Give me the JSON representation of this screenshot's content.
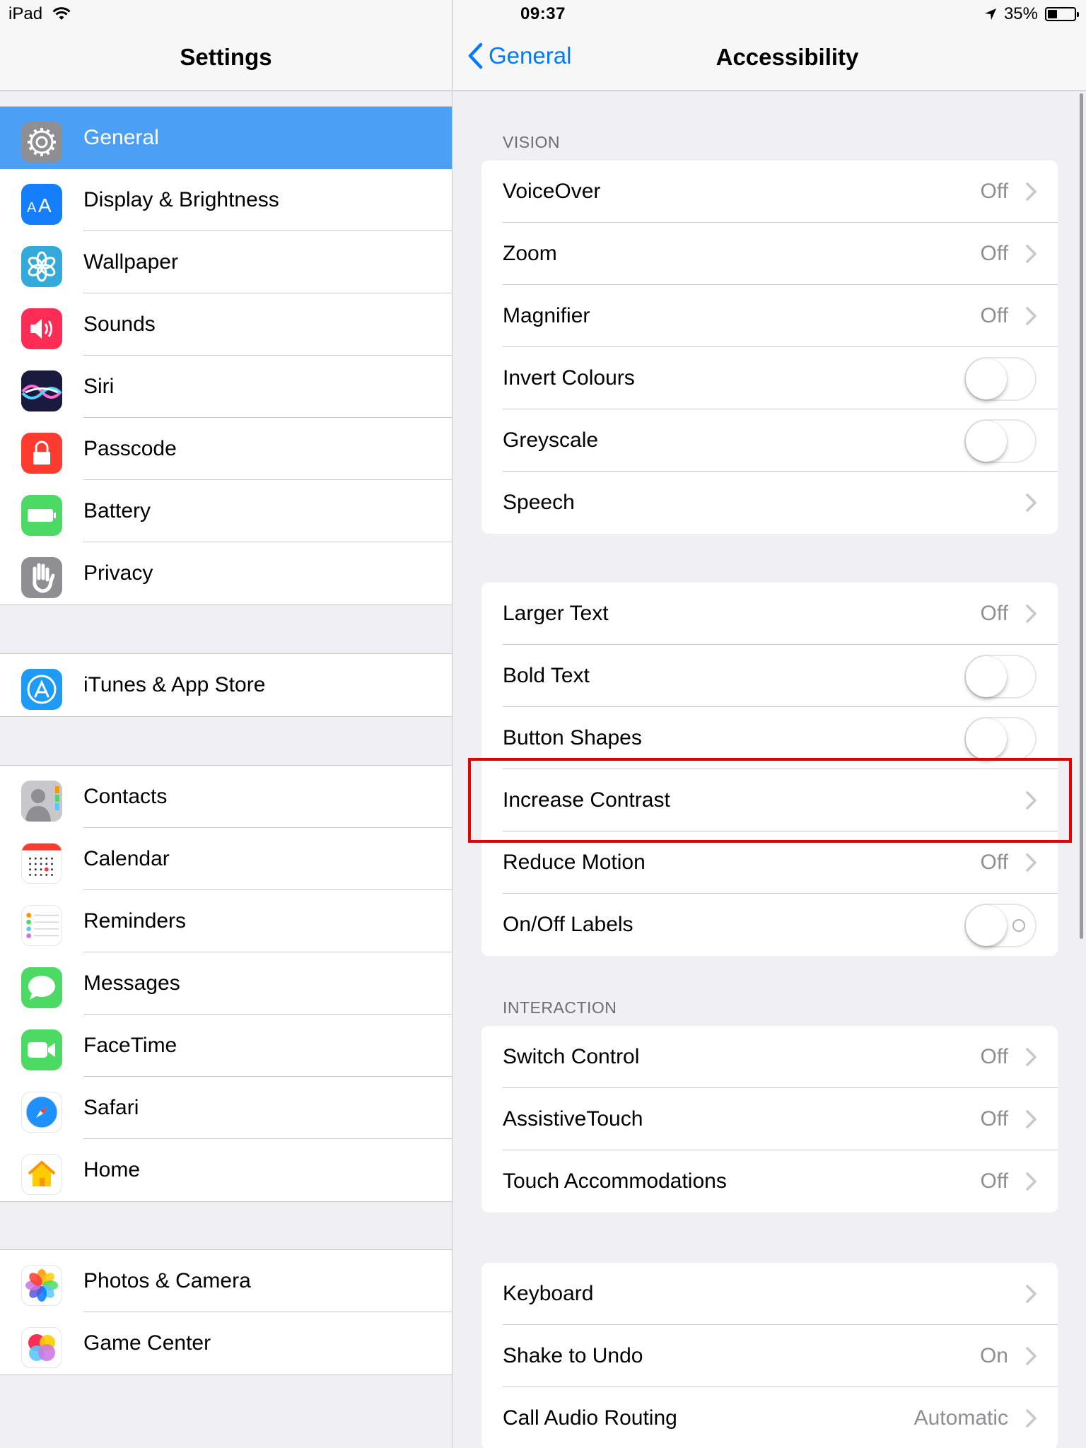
{
  "status": {
    "device": "iPad",
    "time": "09:37",
    "battery": "35%",
    "battery_level": 0.35
  },
  "master": {
    "title": "Settings",
    "groups": [
      [
        {
          "label": "General",
          "icon": "gear-icon",
          "color": "#8e8e93"
        },
        {
          "label": "Display & Brightness",
          "icon": "display-icon",
          "color": "#147efb"
        },
        {
          "label": "Wallpaper",
          "icon": "flower-icon",
          "color": "#34aadc"
        },
        {
          "label": "Sounds",
          "icon": "speaker-icon",
          "color": "#ff2d55"
        },
        {
          "label": "Siri",
          "icon": "siri-icon",
          "color": "#1c1c3a"
        },
        {
          "label": "Passcode",
          "icon": "lock-icon",
          "color": "#ff3b30"
        },
        {
          "label": "Battery",
          "icon": "battery-icon",
          "color": "#4cd964"
        },
        {
          "label": "Privacy",
          "icon": "hand-icon",
          "color": "#8e8e93"
        }
      ],
      [
        {
          "label": "iTunes & App Store",
          "icon": "app-store-icon",
          "color": "#1d9bf6"
        }
      ],
      [
        {
          "label": "Contacts",
          "icon": "contacts-icon",
          "color": "#b9b9bd"
        },
        {
          "label": "Calendar",
          "icon": "calendar-icon",
          "color": "#ffffff"
        },
        {
          "label": "Reminders",
          "icon": "reminders-icon",
          "color": "#ffffff"
        },
        {
          "label": "Messages",
          "icon": "messages-icon",
          "color": "#4cd964"
        },
        {
          "label": "FaceTime",
          "icon": "facetime-icon",
          "color": "#4cd964"
        },
        {
          "label": "Safari",
          "icon": "safari-icon",
          "color": "#ffffff"
        },
        {
          "label": "Home",
          "icon": "home-icon",
          "color": "#ffffff"
        }
      ],
      [
        {
          "label": "Photos & Camera",
          "icon": "photos-icon",
          "color": "#ffffff"
        },
        {
          "label": "Game Center",
          "icon": "game-center-icon",
          "color": "#ffffff"
        }
      ]
    ],
    "selected": "General"
  },
  "detail": {
    "back_label": "General",
    "title": "Accessibility",
    "sections": [
      {
        "header": "VISION",
        "rows": [
          {
            "label": "VoiceOver",
            "value": "Off",
            "kind": "link"
          },
          {
            "label": "Zoom",
            "value": "Off",
            "kind": "link"
          },
          {
            "label": "Magnifier",
            "value": "Off",
            "kind": "link"
          },
          {
            "label": "Invert Colours",
            "value": "",
            "kind": "toggle",
            "on": false
          },
          {
            "label": "Greyscale",
            "value": "",
            "kind": "toggle",
            "on": false
          },
          {
            "label": "Speech",
            "value": "",
            "kind": "link"
          }
        ]
      },
      {
        "header": "",
        "rows": [
          {
            "label": "Larger Text",
            "value": "Off",
            "kind": "link"
          },
          {
            "label": "Bold Text",
            "value": "",
            "kind": "toggle",
            "on": false
          },
          {
            "label": "Button Shapes",
            "value": "",
            "kind": "toggle",
            "on": false
          },
          {
            "label": "Increase Contrast",
            "value": "",
            "kind": "link"
          },
          {
            "label": "Reduce Motion",
            "value": "Off",
            "kind": "link"
          },
          {
            "label": "On/Off Labels",
            "value": "",
            "kind": "toggle",
            "on": false,
            "onoff_labels": true
          }
        ]
      },
      {
        "header": "INTERACTION",
        "rows": [
          {
            "label": "Switch Control",
            "value": "Off",
            "kind": "link"
          },
          {
            "label": "AssistiveTouch",
            "value": "Off",
            "kind": "link"
          },
          {
            "label": "Touch Accommodations",
            "value": "Off",
            "kind": "link"
          }
        ]
      },
      {
        "header": "",
        "rows": [
          {
            "label": "Keyboard",
            "value": "",
            "kind": "link"
          },
          {
            "label": "Shake to Undo",
            "value": "On",
            "kind": "link"
          },
          {
            "label": "Call Audio Routing",
            "value": "Automatic",
            "kind": "link"
          }
        ]
      }
    ]
  },
  "colors": {
    "accent": "#007aff",
    "selected_row": "#4b9ff5",
    "highlight": "#e60000"
  }
}
